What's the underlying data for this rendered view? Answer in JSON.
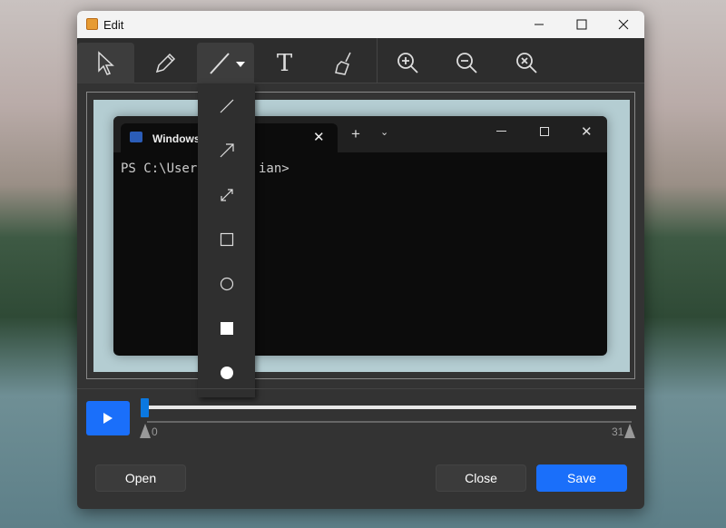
{
  "window": {
    "title": "Edit",
    "minimize": "minimize",
    "maximize": "maximize",
    "close": "close"
  },
  "toolbar": {
    "tools": [
      "select",
      "pencil",
      "line",
      "text",
      "eraser",
      "zoom-in",
      "zoom-out",
      "zoom-reset"
    ],
    "text_tool_glyph": "T"
  },
  "shape_menu": {
    "items": [
      "line",
      "arrow",
      "double-arrow",
      "rectangle",
      "ellipse",
      "filled-rectangle",
      "filled-ellipse"
    ]
  },
  "canvas": {
    "terminal": {
      "tab_title": "Windows",
      "prompt": "PS C:\\User",
      "prompt_tail": "ian>"
    }
  },
  "timeline": {
    "start_label": "0",
    "end_label": "31",
    "position": 0
  },
  "buttons": {
    "open": "Open",
    "close": "Close",
    "save": "Save"
  },
  "colors": {
    "accent": "#1a6ffa",
    "window_bg": "#333333"
  }
}
